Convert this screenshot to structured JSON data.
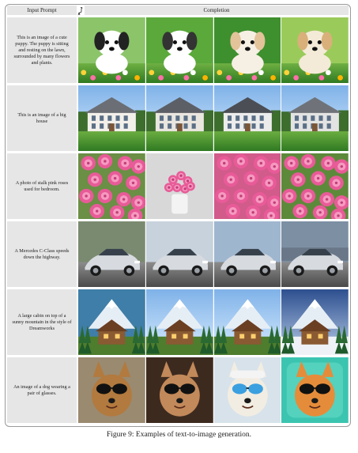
{
  "header": {
    "left_label": "Input Prompt",
    "icon": "ostrich-icon",
    "right_label": "Completion"
  },
  "rows": [
    {
      "prompt": "This is an image of a cute puppy. The puppy is sitting and resting on the lawn, surrounded by many flowers and plants.",
      "theme": "puppy"
    },
    {
      "prompt": "This is an image of a big house",
      "theme": "house"
    },
    {
      "prompt": "A photo of stalk pink roses used for bedroom.",
      "theme": "roses"
    },
    {
      "prompt": "A Mercedes C-Class speeds down the highway.",
      "theme": "car"
    },
    {
      "prompt": "A large cabin on top of a sunny mountain in the style of Dreamworks",
      "theme": "cabin"
    },
    {
      "prompt": "An image of a dog wearing a pair of glasses.",
      "theme": "dog-glasses"
    }
  ],
  "caption": "Figure 9: Examples of text-to-image generation."
}
